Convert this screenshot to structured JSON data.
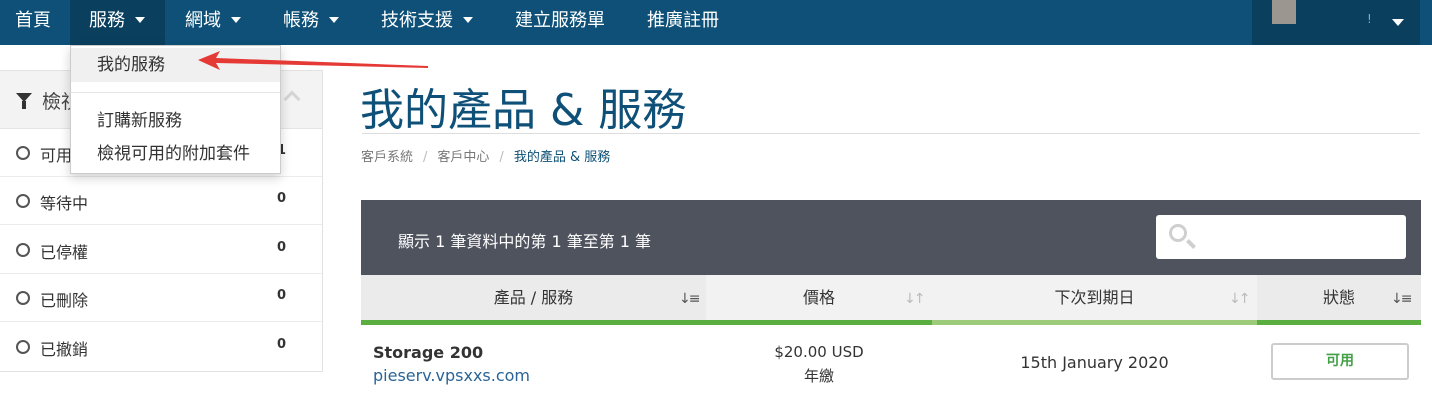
{
  "nav": {
    "items": [
      {
        "label": "首頁",
        "has_caret": false
      },
      {
        "label": "服務",
        "has_caret": true
      },
      {
        "label": "網域",
        "has_caret": true
      },
      {
        "label": "帳務",
        "has_caret": true
      },
      {
        "label": "技術支援",
        "has_caret": true
      },
      {
        "label": "建立服務單",
        "has_caret": false
      },
      {
        "label": "推廣註冊",
        "has_caret": false
      }
    ],
    "user_bang": "!"
  },
  "dropdown": {
    "items": [
      "我的服務",
      "訂購新服務",
      "檢視可用的附加套件"
    ]
  },
  "sidebar": {
    "title": "檢視",
    "items": [
      {
        "label": "可用",
        "count": "1"
      },
      {
        "label": "等待中",
        "count": "0"
      },
      {
        "label": "已停權",
        "count": "0"
      },
      {
        "label": "已刪除",
        "count": "0"
      },
      {
        "label": "已撤銷",
        "count": "0"
      }
    ]
  },
  "page": {
    "title": "我的產品 & 服務",
    "breadcrumb": [
      "客戶系統",
      "客戶中心",
      "我的產品 & 服務"
    ]
  },
  "table": {
    "info": "顯示 1 筆資料中的第 1 筆至第 1 筆",
    "search_placeholder": "",
    "columns": [
      "產品 / 服務",
      "價格",
      "下次到期日",
      "狀態"
    ],
    "rows": [
      {
        "product": "Storage 200",
        "domain": "pieserv.vpsxxs.com",
        "price": "$20.00 USD",
        "cycle": "年繳",
        "due": "15th January 2020",
        "status": "可用"
      }
    ]
  },
  "colors": {
    "nav_bg": "#0e5077",
    "title": "#0e5077",
    "table_header_bar": "#4f535e",
    "sort_underline": "#9ccc7a",
    "status_active": "#43a047",
    "annotation_arrow": "#e53935"
  }
}
